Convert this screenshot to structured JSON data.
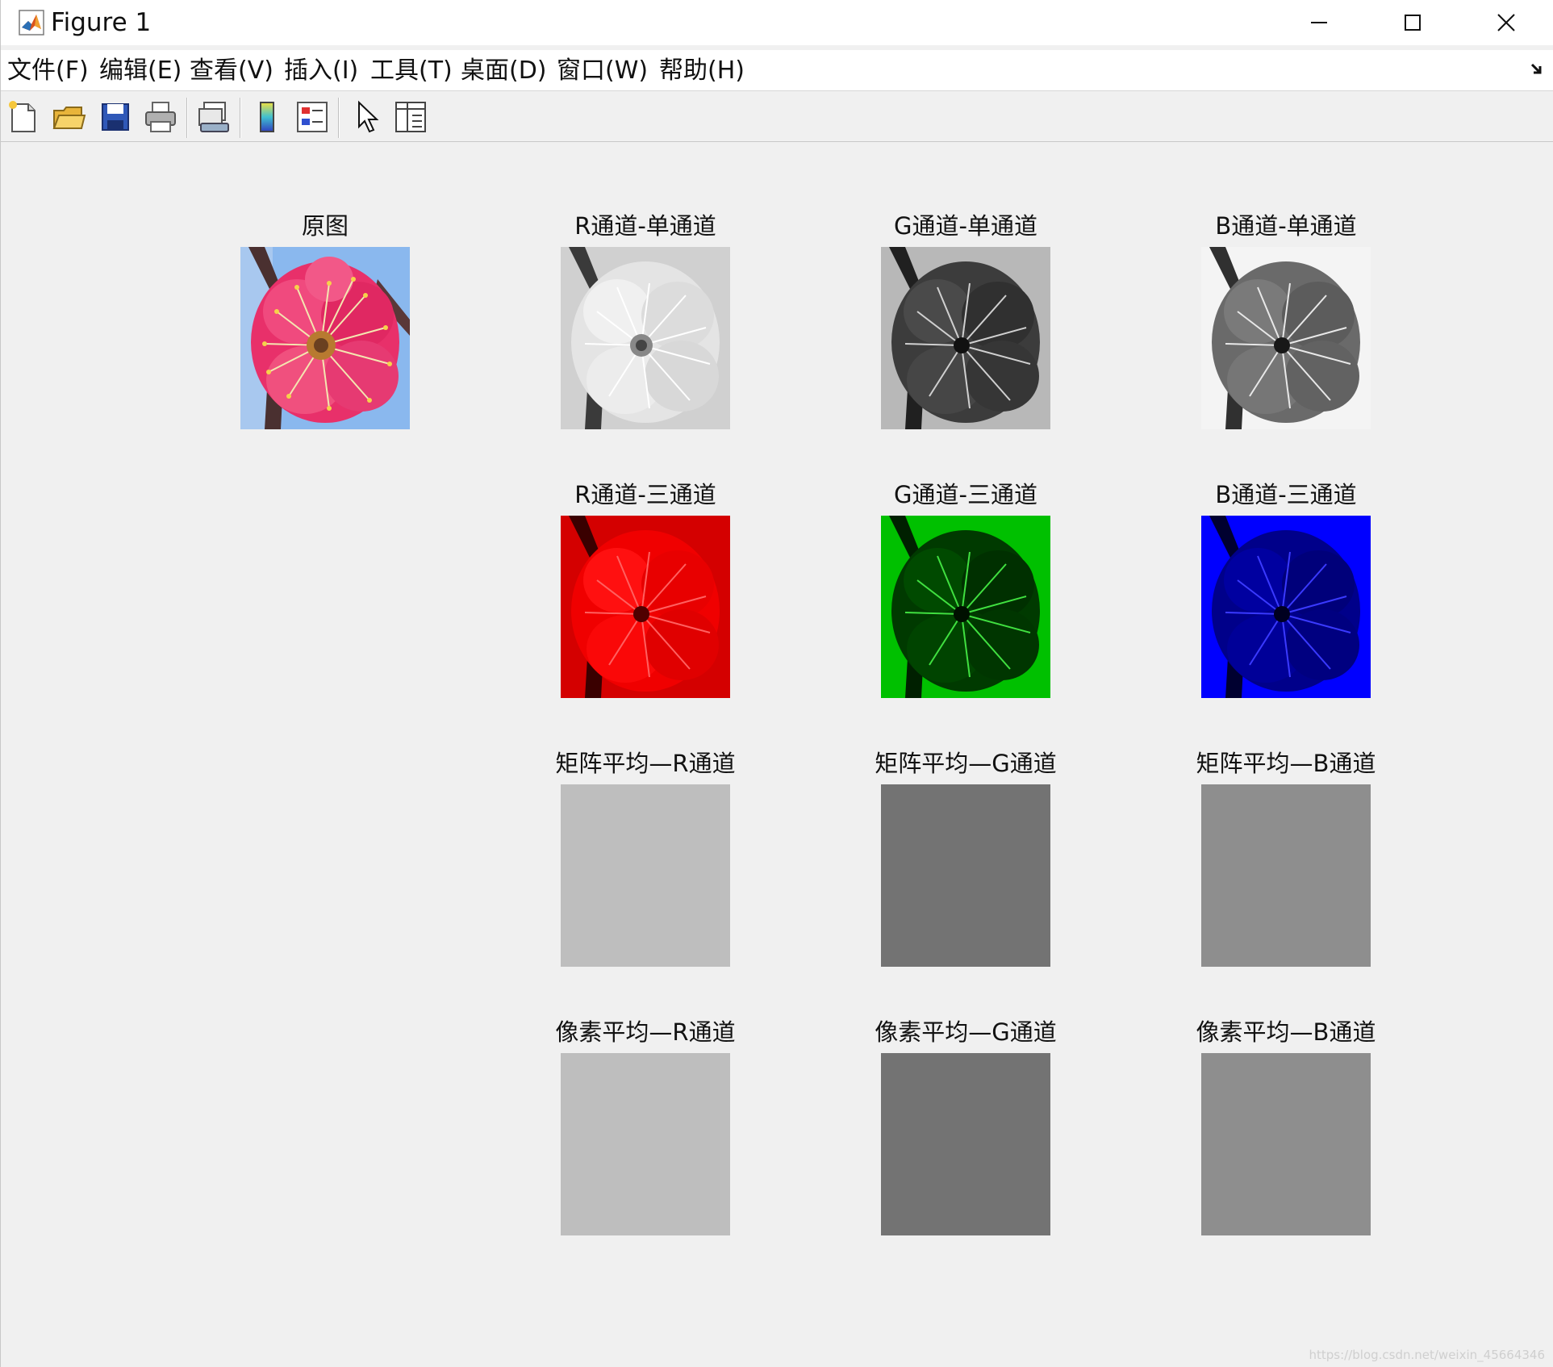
{
  "window": {
    "title": "Figure 1"
  },
  "menu": {
    "items": [
      {
        "label": "文件(F)",
        "name": "menu-file"
      },
      {
        "label": "编辑(E)",
        "name": "menu-edit"
      },
      {
        "label": "查看(V)",
        "name": "menu-view"
      },
      {
        "label": "插入(I)",
        "name": "menu-insert"
      },
      {
        "label": "工具(T)",
        "name": "menu-tools"
      },
      {
        "label": "桌面(D)",
        "name": "menu-desktop"
      },
      {
        "label": "窗口(W)",
        "name": "menu-window"
      },
      {
        "label": "帮助(H)",
        "name": "menu-help"
      }
    ]
  },
  "toolbar": {
    "icons": [
      "new-figure-icon",
      "open-file-icon",
      "save-icon",
      "print-icon",
      "link-plot-icon",
      "colorbar-icon",
      "legend-icon",
      "pointer-icon",
      "property-inspector-icon"
    ]
  },
  "subplots": {
    "original": {
      "title": "原图"
    },
    "r_single": {
      "title": "R通道-单通道"
    },
    "g_single": {
      "title": "G通道-单通道"
    },
    "b_single": {
      "title": "B通道-单通道"
    },
    "r_three": {
      "title": "R通道-三通道"
    },
    "g_three": {
      "title": "G通道-三通道"
    },
    "b_three": {
      "title": "B通道-三通道"
    },
    "r_matrix_mean": {
      "title": "矩阵平均—R通道",
      "gray": "#bebebe"
    },
    "g_matrix_mean": {
      "title": "矩阵平均—G通道",
      "gray": "#737373"
    },
    "b_matrix_mean": {
      "title": "矩阵平均—B通道",
      "gray": "#8e8e8e"
    },
    "r_pixel_mean": {
      "title": "像素平均—R通道",
      "gray": "#bebebe"
    },
    "g_pixel_mean": {
      "title": "像素平均—G通道",
      "gray": "#737373"
    },
    "b_pixel_mean": {
      "title": "像素平均—B通道",
      "gray": "#8e8e8e"
    }
  },
  "colors": {
    "red_channel": "#ff0000",
    "green_channel": "#00c800",
    "blue_channel": "#0000ff",
    "petal_pink": "#e8306a",
    "sky_blue": "#8ab8ee"
  },
  "watermark": "https://blog.csdn.net/weixin_45664346"
}
